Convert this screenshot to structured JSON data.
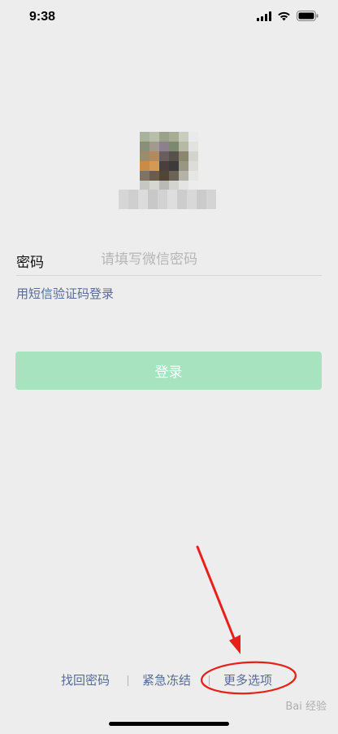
{
  "status_bar": {
    "time": "9:38"
  },
  "password_row": {
    "label": "密码",
    "placeholder": "请填写微信密码",
    "value": ""
  },
  "sms_login_link": "用短信验证码登录",
  "login_button": {
    "label": "登录",
    "color": "#a8e3c0"
  },
  "bottom_links": {
    "recover_password": "找回密码",
    "emergency_freeze": "紧急冻结",
    "more_options": "更多选项"
  },
  "watermark": "Bai 经验",
  "colors": {
    "link": "#576b95",
    "background": "#ededed",
    "annotation": "#e8201a"
  },
  "icons": [
    "signal-icon",
    "wifi-icon",
    "battery-icon"
  ]
}
